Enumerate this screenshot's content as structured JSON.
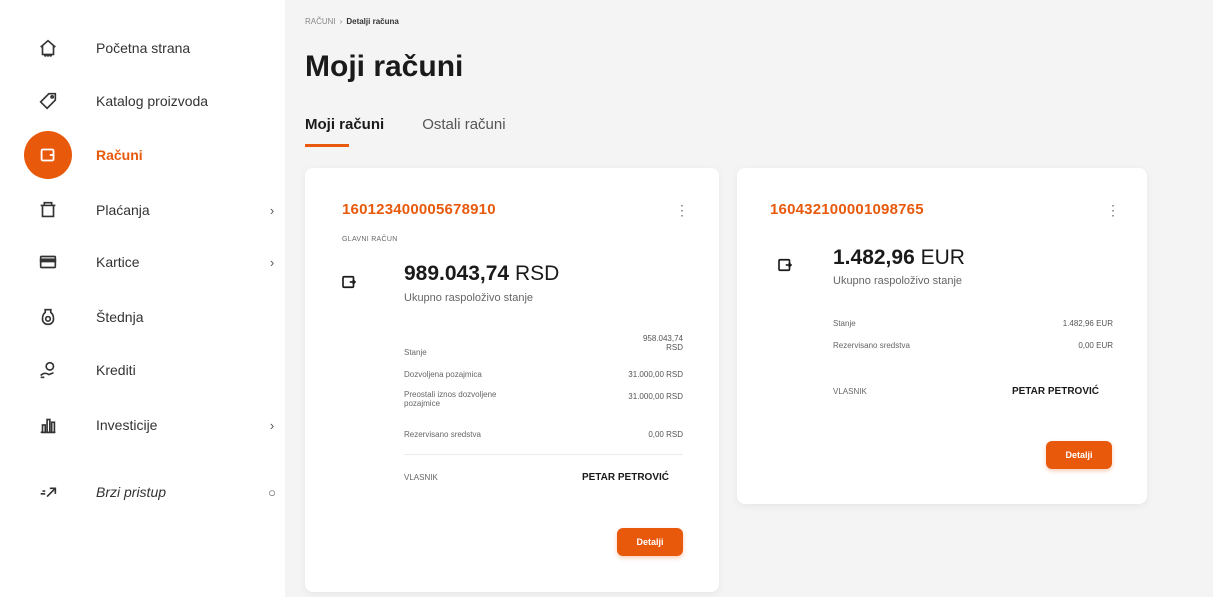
{
  "sidebar": {
    "items": [
      {
        "label": "Početna strana",
        "icon": "home-icon",
        "chevron": ""
      },
      {
        "label": "Katalog proizvoda",
        "icon": "tag-icon",
        "chevron": ""
      },
      {
        "label": "Računi",
        "icon": "wallet-icon",
        "chevron": ""
      },
      {
        "label": "Plaćanja",
        "icon": "basket-icon",
        "chevron": "›"
      },
      {
        "label": "Kartice",
        "icon": "card-icon",
        "chevron": "›"
      },
      {
        "label": "Štednja",
        "icon": "savings-jar-icon",
        "chevron": ""
      },
      {
        "label": "Krediti",
        "icon": "hand-coin-icon",
        "chevron": ""
      },
      {
        "label": "Investicije",
        "icon": "bar-chart-icon",
        "chevron": "›"
      },
      {
        "label": "Brzi pristup",
        "icon": "quick-access-icon",
        "chevron": "○"
      }
    ]
  },
  "breadcrumb": {
    "parent": "RAČUNI",
    "separator": "›",
    "current": "Detalji računa"
  },
  "page_title": "Moji računi",
  "tabs": [
    {
      "label": "Moji računi",
      "active": true
    },
    {
      "label": "Ostali računi",
      "active": false
    }
  ],
  "accounts": [
    {
      "number": "160123400005678910",
      "type_label": "GLAVNI RAČUN",
      "balance_amount": "989.043,74",
      "balance_currency": "RSD",
      "balance_caption": "Ukupno raspoloživo stanje",
      "rows": [
        {
          "label": "Stanje",
          "value_line1": "958.043,74",
          "value_line2": "RSD"
        },
        {
          "label": "Dozvoljena pozajmica",
          "value": "31.000,00 RSD"
        },
        {
          "label_line1": "Preostali iznos dozvoljene",
          "label_line2": "pozajmice",
          "value": "31.000,00 RSD"
        },
        {
          "label": "Rezervisano sredstva",
          "value": "0,00 RSD"
        }
      ],
      "owner_label": "VLASNIK",
      "owner_value": "PETAR PETROVIĆ",
      "button_label": "Detalji"
    },
    {
      "number": "160432100001098765",
      "balance_amount": "1.482,96",
      "balance_currency": "EUR",
      "balance_caption": "Ukupno raspoloživo stanje",
      "rows": [
        {
          "label": "Stanje",
          "value": "1.482,96 EUR"
        },
        {
          "label": "Rezervisano sredstva",
          "value": "0,00 EUR"
        }
      ],
      "owner_label": "VLASNIK",
      "owner_value": "PETAR PETROVIĆ",
      "button_label": "Detalji"
    }
  ],
  "colors": {
    "accent": "#e8590c",
    "background": "#f4f4f4",
    "card": "#ffffff"
  }
}
